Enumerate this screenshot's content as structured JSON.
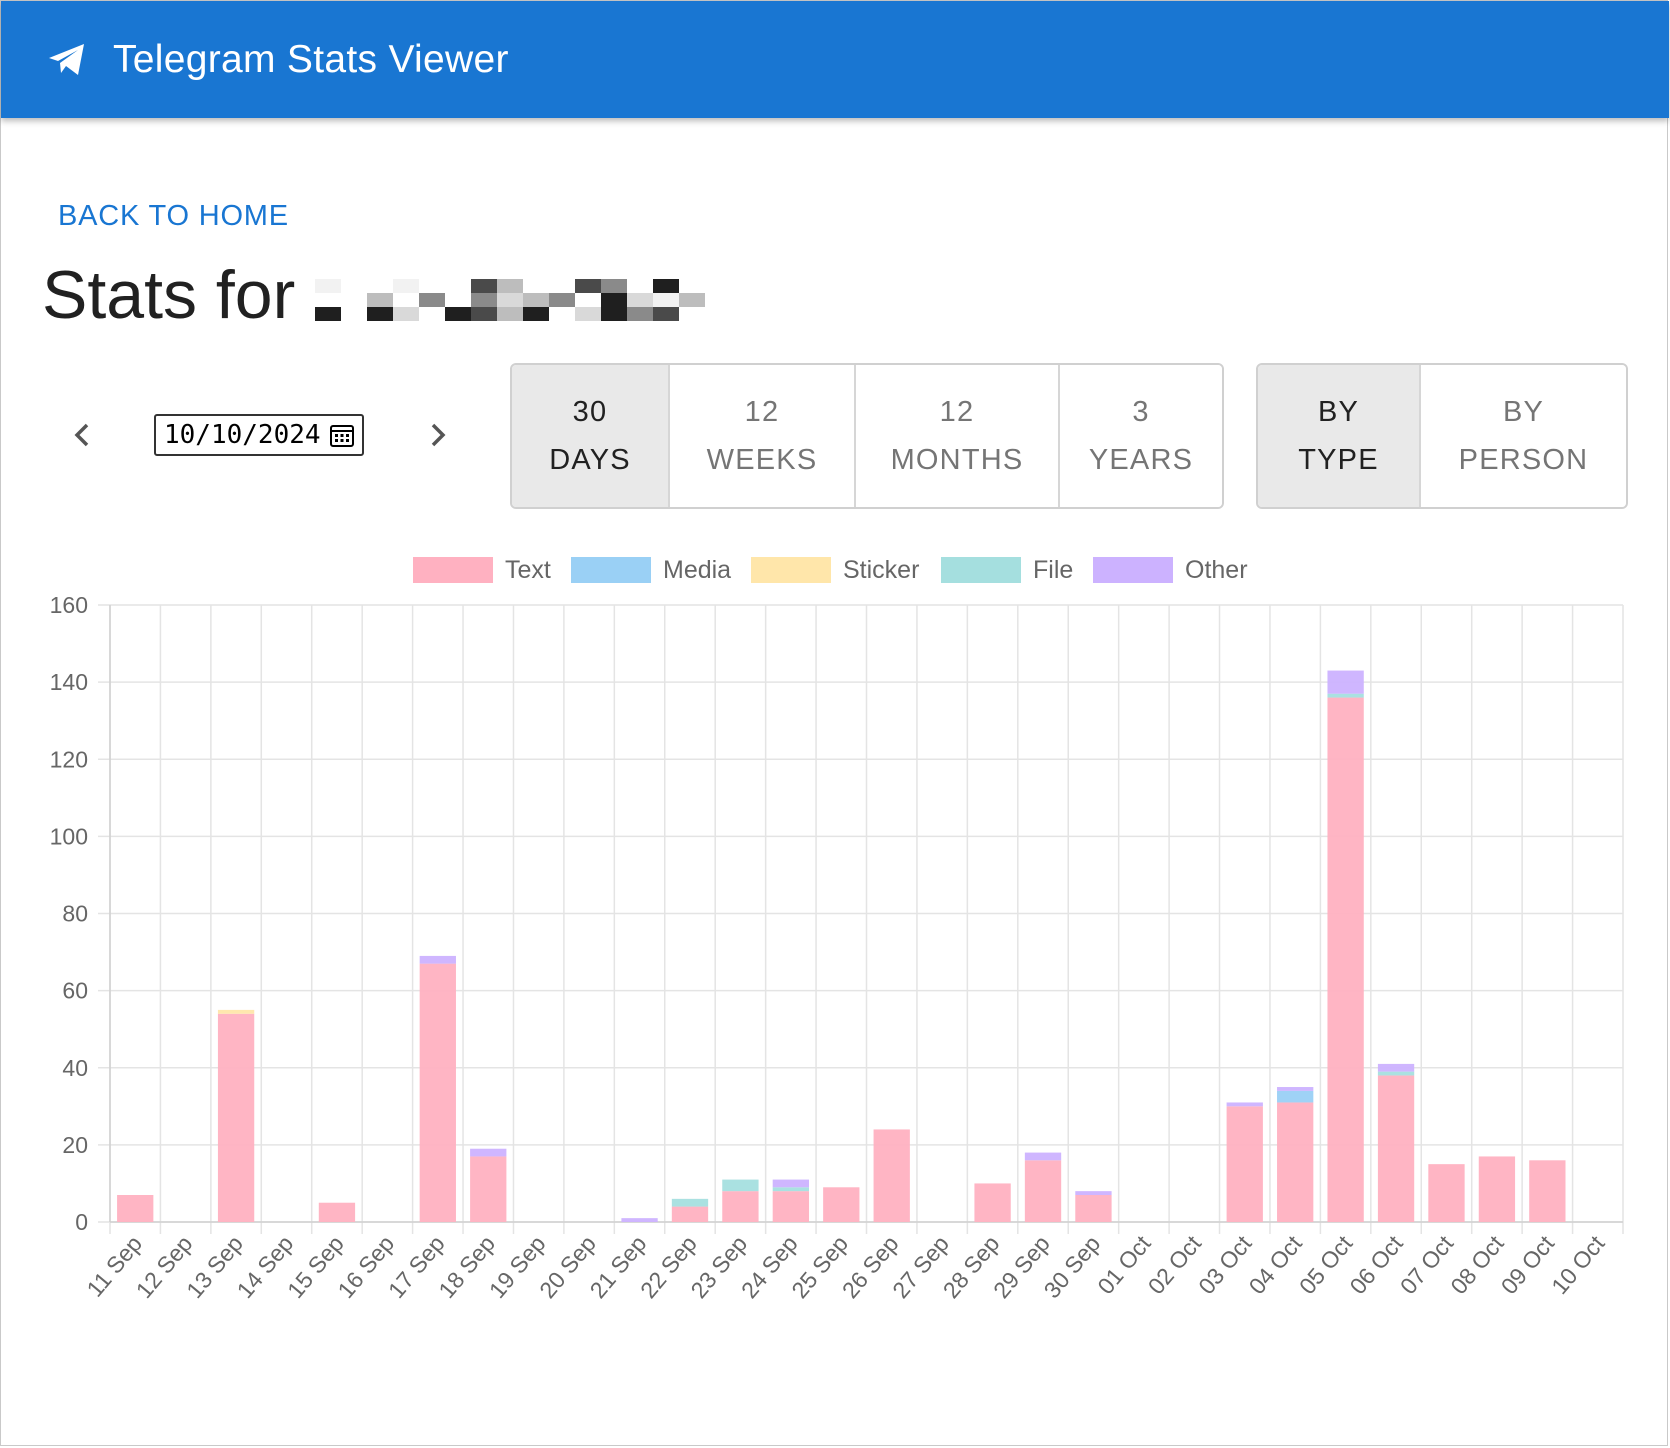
{
  "app": {
    "title": "Telegram Stats Viewer",
    "icon": "telegram-plane-icon",
    "brand_color": "#1976d2"
  },
  "nav": {
    "back_label": "BACK TO HOME"
  },
  "page": {
    "heading_prefix": "Stats for",
    "heading_name_redacted": true
  },
  "date_picker": {
    "value": "10/10/2024",
    "prev_icon": "chevron-left-icon",
    "next_icon": "chevron-right-icon",
    "calendar_icon": "calendar-icon"
  },
  "period_tabs": [
    {
      "line1": "30",
      "line2": "DAYS",
      "active": true
    },
    {
      "line1": "12",
      "line2": "WEEKS",
      "active": false
    },
    {
      "line1": "12",
      "line2": "MONTHS",
      "active": false
    },
    {
      "line1": "3",
      "line2": "YEARS",
      "active": false
    }
  ],
  "group_tabs": [
    {
      "line1": "BY",
      "line2": "TYPE",
      "active": true
    },
    {
      "line1": "BY",
      "line2": "PERSON",
      "active": false
    }
  ],
  "chart_data": {
    "type": "bar",
    "stacked": true,
    "legend_position": "top",
    "grid": true,
    "ylim": [
      0,
      160
    ],
    "yticks": [
      0,
      20,
      40,
      60,
      80,
      100,
      120,
      140,
      160
    ],
    "categories": [
      "11 Sep",
      "12 Sep",
      "13 Sep",
      "14 Sep",
      "15 Sep",
      "16 Sep",
      "17 Sep",
      "18 Sep",
      "19 Sep",
      "20 Sep",
      "21 Sep",
      "22 Sep",
      "23 Sep",
      "24 Sep",
      "25 Sep",
      "26 Sep",
      "27 Sep",
      "28 Sep",
      "29 Sep",
      "30 Sep",
      "01 Oct",
      "02 Oct",
      "03 Oct",
      "04 Oct",
      "05 Oct",
      "06 Oct",
      "07 Oct",
      "08 Oct",
      "09 Oct",
      "10 Oct"
    ],
    "series": [
      {
        "name": "Text",
        "color": "#ffb1c1",
        "values": [
          7,
          0,
          54,
          0,
          5,
          0,
          67,
          17,
          0,
          0,
          0,
          4,
          8,
          8,
          9,
          24,
          0,
          10,
          16,
          7,
          0,
          0,
          30,
          31,
          136,
          38,
          15,
          17,
          16,
          0
        ]
      },
      {
        "name": "Media",
        "color": "#9ad0f5",
        "values": [
          0,
          0,
          0,
          0,
          0,
          0,
          0,
          0,
          0,
          0,
          0,
          0,
          0,
          0,
          0,
          0,
          0,
          0,
          0,
          0,
          0,
          0,
          0,
          3,
          0,
          0,
          0,
          0,
          0,
          0
        ]
      },
      {
        "name": "Sticker",
        "color": "#ffe6aa",
        "values": [
          0,
          0,
          1,
          0,
          0,
          0,
          0,
          0,
          0,
          0,
          0,
          0,
          0,
          0,
          0,
          0,
          0,
          0,
          0,
          0,
          0,
          0,
          0,
          0,
          0,
          0,
          0,
          0,
          0,
          0
        ]
      },
      {
        "name": "File",
        "color": "#a5dfdf",
        "values": [
          0,
          0,
          0,
          0,
          0,
          0,
          0,
          0,
          0,
          0,
          0,
          2,
          3,
          1,
          0,
          0,
          0,
          0,
          0,
          0,
          0,
          0,
          0,
          0,
          1,
          1,
          0,
          0,
          0,
          0
        ]
      },
      {
        "name": "Other",
        "color": "#ccb2ff",
        "values": [
          0,
          0,
          0,
          0,
          0,
          0,
          2,
          2,
          0,
          0,
          1,
          0,
          0,
          2,
          0,
          0,
          0,
          0,
          2,
          1,
          0,
          0,
          1,
          1,
          6,
          2,
          0,
          0,
          0,
          0
        ]
      }
    ]
  }
}
